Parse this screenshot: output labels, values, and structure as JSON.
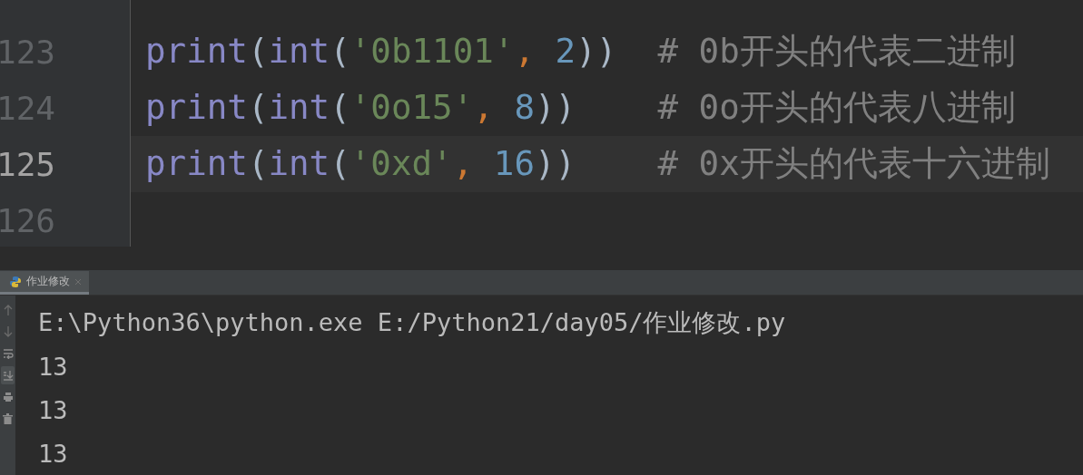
{
  "editor": {
    "lines": [
      {
        "number": "123",
        "current": false,
        "tokens": [
          {
            "kind": "func",
            "text": "print"
          },
          {
            "kind": "paren",
            "text": "("
          },
          {
            "kind": "func",
            "text": "int"
          },
          {
            "kind": "paren",
            "text": "("
          },
          {
            "kind": "string",
            "text": "'0b1101'"
          },
          {
            "kind": "comma",
            "text": ", "
          },
          {
            "kind": "number",
            "text": "2"
          },
          {
            "kind": "paren",
            "text": "))"
          },
          {
            "kind": "comment",
            "text": "  # 0b开头的代表二进制"
          }
        ]
      },
      {
        "number": "124",
        "current": false,
        "tokens": [
          {
            "kind": "func",
            "text": "print"
          },
          {
            "kind": "paren",
            "text": "("
          },
          {
            "kind": "func",
            "text": "int"
          },
          {
            "kind": "paren",
            "text": "("
          },
          {
            "kind": "string",
            "text": "'0o15'"
          },
          {
            "kind": "comma",
            "text": ", "
          },
          {
            "kind": "number",
            "text": "8"
          },
          {
            "kind": "paren",
            "text": "))"
          },
          {
            "kind": "comment",
            "text": "    # 0o开头的代表八进制"
          }
        ]
      },
      {
        "number": "125",
        "current": true,
        "tokens": [
          {
            "kind": "func",
            "text": "print"
          },
          {
            "kind": "paren",
            "text": "("
          },
          {
            "kind": "func",
            "text": "int"
          },
          {
            "kind": "paren",
            "text": "("
          },
          {
            "kind": "string",
            "text": "'0xd'"
          },
          {
            "kind": "comma",
            "text": ", "
          },
          {
            "kind": "number",
            "text": "16"
          },
          {
            "kind": "paren",
            "text": "))"
          },
          {
            "kind": "comment",
            "text": "    # 0x开头的代表十六进制"
          }
        ]
      },
      {
        "number": "126",
        "current": false
      }
    ]
  },
  "run_panel": {
    "tabs": [
      {
        "label": "作业修改",
        "selected": true
      }
    ],
    "toolbar": [
      {
        "kind": "up",
        "selected": false
      },
      {
        "kind": "down",
        "selected": false
      },
      {
        "kind": "wrap",
        "selected": false
      },
      {
        "kind": "scroll",
        "selected": true
      },
      {
        "kind": "print",
        "selected": false
      },
      {
        "kind": "trash",
        "selected": false
      }
    ],
    "output": [
      "E:\\Python36\\python.exe E:/Python21/day05/作业修改.py",
      "13",
      "13",
      "13"
    ]
  }
}
